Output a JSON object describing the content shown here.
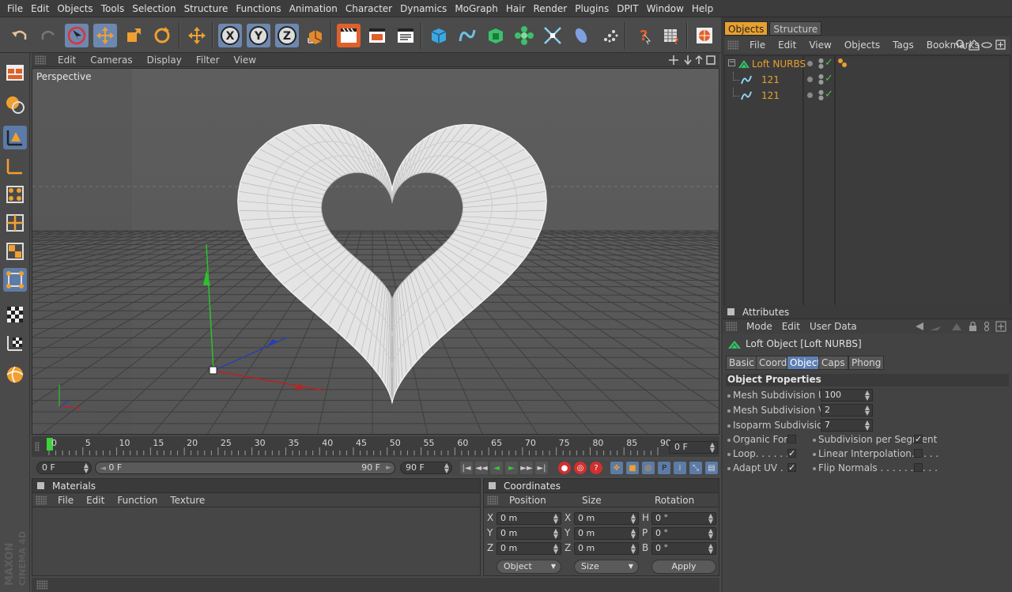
{
  "menu": [
    "File",
    "Edit",
    "Objects",
    "Tools",
    "Selection",
    "Structure",
    "Functions",
    "Animation",
    "Character",
    "Dynamics",
    "MoGraph",
    "Hair",
    "Render",
    "Plugins",
    "DPIT",
    "Window",
    "Help"
  ],
  "toolbar": {
    "icons": [
      "undo-icon",
      "redo-icon",
      "live-selection-icon",
      "move-icon",
      "scale-icon",
      "rotate-icon",
      "move-axis-icon",
      "x-axis-lock-icon",
      "y-axis-lock-icon",
      "z-axis-lock-icon",
      "coordinate-system-icon",
      "render-view-icon",
      "render-picture-viewer-icon",
      "render-settings-icon",
      "cube-primitive-icon",
      "spline-icon",
      "nurbs-icon",
      "array-icon",
      "deformer-icon",
      "camera-icon",
      "light-icon",
      "environment-icon",
      "help-icon",
      "timeline-icon",
      "content-browser-icon"
    ],
    "axis_labels": {
      "x": "X",
      "y": "Y",
      "z": "Z"
    }
  },
  "viewport": {
    "menu": [
      "Edit",
      "Cameras",
      "Display",
      "Filter",
      "View"
    ],
    "label": "Perspective"
  },
  "timeline": {
    "ticks": [
      "0",
      "5",
      "10",
      "15",
      "20",
      "25",
      "30",
      "35",
      "40",
      "45",
      "50",
      "55",
      "60",
      "65",
      "70",
      "75",
      "80",
      "85",
      "90"
    ],
    "current_frame": "0 F",
    "start_field": "0 F",
    "range_start": "0 F",
    "range_end": "90 F",
    "end_field": "90 F"
  },
  "materials": {
    "title": "Materials",
    "menu": [
      "File",
      "Edit",
      "Function",
      "Texture"
    ]
  },
  "coordinates": {
    "title": "Coordinates",
    "headers": [
      "Position",
      "Size",
      "Rotation"
    ],
    "pos_labels": [
      "X",
      "Y",
      "Z"
    ],
    "size_labels": [
      "X",
      "Y",
      "Z"
    ],
    "rot_labels": [
      "H",
      "P",
      "B"
    ],
    "pos_values": [
      "0 m",
      "0 m",
      "0 m"
    ],
    "size_values": [
      "0 m",
      "0 m",
      "0 m"
    ],
    "rot_values": [
      "0 °",
      "0 °",
      "0 °"
    ],
    "mode_select": "Object",
    "size_select": "Size",
    "apply_label": "Apply"
  },
  "objects_panel": {
    "tabs": [
      "Objects",
      "Structure"
    ],
    "menu": [
      "File",
      "Edit",
      "View",
      "Objects",
      "Tags",
      "Bookmarks"
    ],
    "items": [
      {
        "name": "Loft NURBS",
        "indent": 0
      },
      {
        "name": "121",
        "indent": 1
      },
      {
        "name": "121",
        "indent": 1
      }
    ]
  },
  "attributes": {
    "title": "Attributes",
    "menu": [
      "Mode",
      "Edit",
      "User Data"
    ],
    "object_title": "Loft Object [Loft NURBS]",
    "tabs": [
      "Basic",
      "Coord.",
      "Object",
      "Caps",
      "Phong"
    ],
    "selected_tab": "Object",
    "section": "Object Properties",
    "mesh_u_label": "Mesh Subdivision U . .",
    "mesh_u": "100",
    "mesh_v_label": "Mesh Subdivision V . .",
    "mesh_v": "2",
    "isoparm_label": "Isoparm Subdivision U",
    "isoparm": "7",
    "organic_label": "Organic Form",
    "organic": false,
    "subdiv_seg_label": "Subdivision per Segment",
    "subdiv_seg": true,
    "loop_label": "Loop. . . . . . .",
    "loop": true,
    "linear_label": "Linear Interpolation. . . . .",
    "linear": false,
    "adapt_label": "Adapt UV . . .",
    "adapt": true,
    "flip_label": "Flip Normals . . . . . . . . . .",
    "flip": false
  },
  "branding": {
    "logo_text": "MAXON CINEMA 4D"
  }
}
